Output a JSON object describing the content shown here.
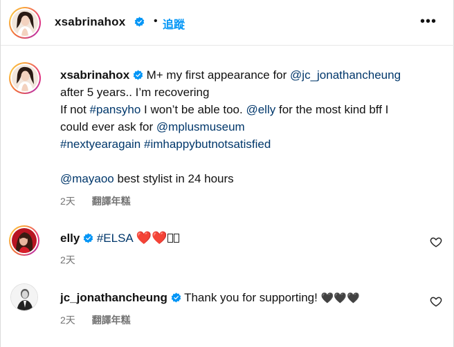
{
  "header": {
    "username": "xsabrinahox",
    "dot": "•",
    "follow_label": "追蹤",
    "more_label": "•••",
    "icons": {
      "avatar": "profile-photo",
      "verified": "verified-badge-icon",
      "more": "more-options-icon"
    }
  },
  "caption": {
    "username": "xsabrinahox",
    "line1_text": "M+ my first appearance for",
    "line1_mention": "@jc_jonathancheung",
    "line2": "after 5 years.. I’m recovering",
    "line3_pre": "If not",
    "line3_tag": "#pansyho",
    "line3_mid": "I won’t be able too.",
    "line3_mention": "@elly",
    "line3_post": "for the most kind bff I",
    "line4_pre": "could ever ask for",
    "line4_mention": "@mplusmuseum",
    "line5_tag1": "#nextyearagain",
    "line5_tag2": "#imhappybutnotsatisfied",
    "line6_mention": "@mayaoo",
    "line6_text": "best stylist in 24 hours",
    "time": "2天",
    "translate_label": "翻譯年糕"
  },
  "comments": [
    {
      "username": "elly",
      "tag": "#ELSA",
      "hearts": "❤️❤️",
      "time": "2天",
      "icons": {
        "avatar": "profile-photo",
        "like": "heart-outline-icon"
      }
    },
    {
      "username": "jc_jonathancheung",
      "text": "Thank you for supporting!",
      "hearts": "🖤🖤🖤",
      "time": "2天",
      "translate_label": "翻譯年糕",
      "icons": {
        "avatar": "profile-photo",
        "like": "heart-outline-icon"
      }
    }
  ],
  "colors": {
    "link": "#00376b",
    "follow": "#0095f6",
    "verified": "#0095f6",
    "meta": "#737373",
    "heart": "#e3132c"
  }
}
